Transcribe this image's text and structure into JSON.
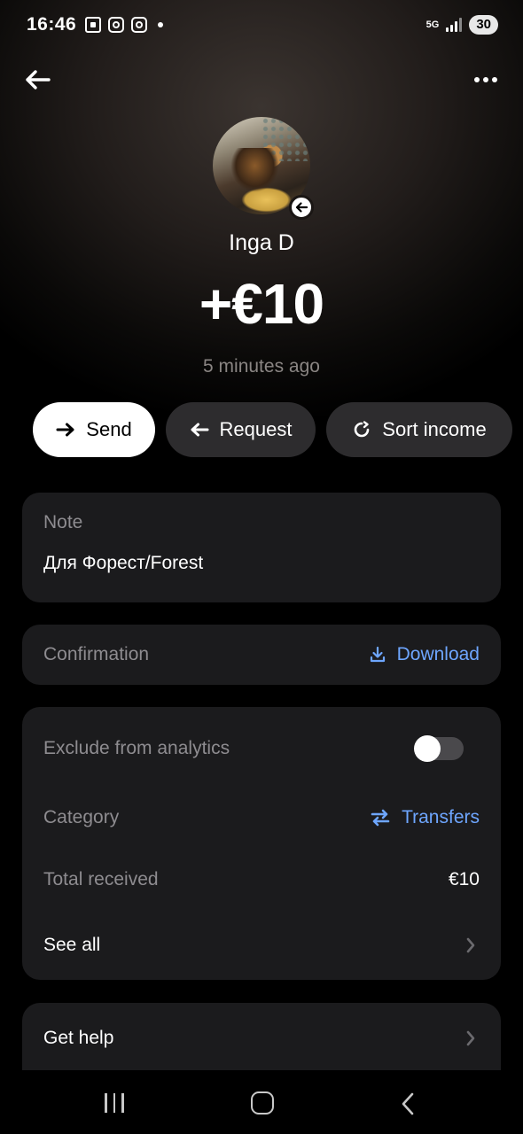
{
  "status_bar": {
    "time": "16:46",
    "network": "5G",
    "battery": "30"
  },
  "header": {
    "back_icon": "arrow-left-icon",
    "more_icon": "more-dots-icon"
  },
  "transaction": {
    "name": "Inga D",
    "amount": "+€10",
    "time_ago": "5 minutes ago",
    "badge_icon": "incoming-arrow-icon"
  },
  "actions": {
    "send": "Send",
    "request": "Request",
    "sort_income": "Sort income"
  },
  "note": {
    "label": "Note",
    "text": "Для Форест/Forest"
  },
  "confirmation": {
    "label": "Confirmation",
    "action": "Download"
  },
  "details": {
    "exclude_label": "Exclude from analytics",
    "exclude_enabled": false,
    "category_label": "Category",
    "category_value": "Transfers",
    "total_label": "Total received",
    "total_value": "€10",
    "see_all": "See all"
  },
  "help": {
    "label": "Get help"
  },
  "colors": {
    "accent": "#6ea6ff",
    "card": "#1b1b1d",
    "muted": "#8e8c90"
  }
}
